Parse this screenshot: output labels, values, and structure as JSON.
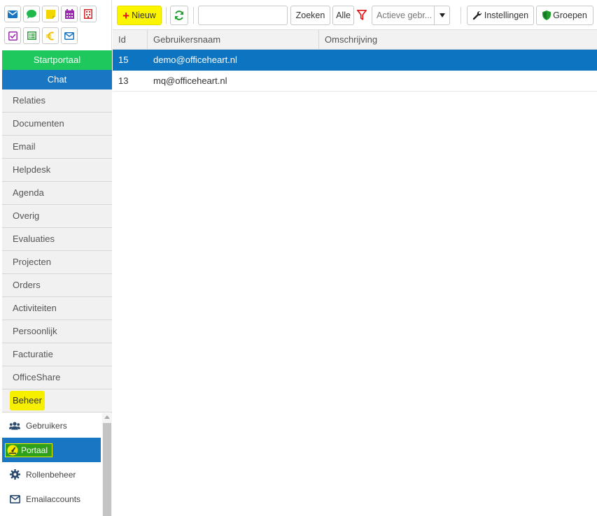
{
  "icons": {
    "row1": [
      "mail-icon",
      "chat-bubble-icon",
      "sticky-note-icon",
      "calendar-icon",
      "building-icon"
    ],
    "row2": [
      "checkbox-icon",
      "list-icon",
      "euro-icon",
      "envelope-outline-icon"
    ]
  },
  "portal": {
    "start": "Startportaal",
    "chat": "Chat"
  },
  "menu": {
    "items": [
      "Relaties",
      "Documenten",
      "Email",
      "Helpdesk",
      "Agenda",
      "Overig",
      "Evaluaties",
      "Projecten",
      "Orders",
      "Activiteiten",
      "Persoonlijk",
      "Facturatie",
      "OfficeShare",
      "Beheer"
    ],
    "highlighted": "Beheer"
  },
  "submenu": {
    "items": [
      {
        "label": "Gebruikers",
        "icon": "users-icon"
      },
      {
        "label": "Portaal",
        "icon": "dashboard-icon"
      },
      {
        "label": "Rollenbeheer",
        "icon": "cog-icon"
      },
      {
        "label": "Emailaccounts",
        "icon": "envelope-icon"
      }
    ],
    "active": "Portaal"
  },
  "toolbar": {
    "new_label": "Nieuw",
    "search_value": "",
    "search_label": "Zoeken",
    "all_label": "Alle",
    "filter_selected": "Actieve gebr...",
    "settings_label": "Instellingen",
    "groups_label": "Groepen"
  },
  "grid": {
    "columns": [
      "Id",
      "Gebruikersnaam",
      "Omschrijving"
    ],
    "rows": [
      {
        "id": "15",
        "username": "demo@officeheart.nl",
        "description": "",
        "selected": true
      },
      {
        "id": "13",
        "username": "mq@officeheart.nl",
        "description": "",
        "selected": false
      }
    ]
  },
  "colors": {
    "start_green": "#1ec85d",
    "chat_blue": "#1976c2",
    "selected_row": "#0d74c1",
    "highlight_yellow": "#f6f000",
    "filter_red": "#e01010"
  }
}
